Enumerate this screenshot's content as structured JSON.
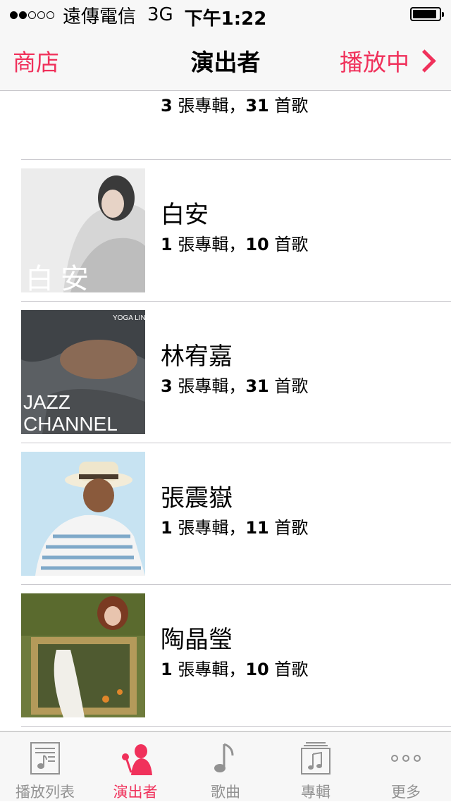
{
  "status_bar": {
    "carrier": "遠傳電信",
    "network": "3G",
    "time": "下午1:22",
    "signal_bars": 2,
    "signal_total": 5,
    "battery_level": 0.92
  },
  "nav": {
    "left_label": "商店",
    "title": "演出者",
    "right_label": "播放中"
  },
  "artists": [
    {
      "name": "",
      "albums": "3",
      "albums_unit": "張專輯，",
      "songs": "31",
      "songs_unit": "首歌",
      "art_icon": "album-art-red-hair"
    },
    {
      "name": "白安",
      "albums": "1",
      "albums_unit": "張專輯，",
      "songs": "10",
      "songs_unit": "首歌",
      "art_icon": "album-art-bai-an"
    },
    {
      "name": "林宥嘉",
      "albums": "3",
      "albums_unit": "張專輯，",
      "songs": "31",
      "songs_unit": "首歌",
      "art_icon": "album-art-jazz-channel",
      "art_text_1": "YOGA LIN",
      "art_text_2": "JAZZ",
      "art_text_3": "CHANNEL"
    },
    {
      "name": "張震嶽",
      "albums": "1",
      "albums_unit": "張專輯，",
      "songs": "11",
      "songs_unit": "首歌",
      "art_icon": "album-art-hat-man"
    },
    {
      "name": "陶晶瑩",
      "albums": "1",
      "albums_unit": "張專輯，",
      "songs": "10",
      "songs_unit": "首歌",
      "art_icon": "album-art-puppet"
    }
  ],
  "tabs": [
    {
      "label": "播放列表",
      "icon": "playlist-icon",
      "active": false
    },
    {
      "label": "演出者",
      "icon": "artist-icon",
      "active": true
    },
    {
      "label": "歌曲",
      "icon": "music-note-icon",
      "active": false
    },
    {
      "label": "專輯",
      "icon": "album-icon",
      "active": false
    },
    {
      "label": "更多",
      "icon": "more-icon",
      "active": false
    }
  ],
  "colors": {
    "accent": "#f0315b",
    "inactive": "#929292",
    "bar_background": "#f7f7f7",
    "separator": "#c8c7cc"
  }
}
